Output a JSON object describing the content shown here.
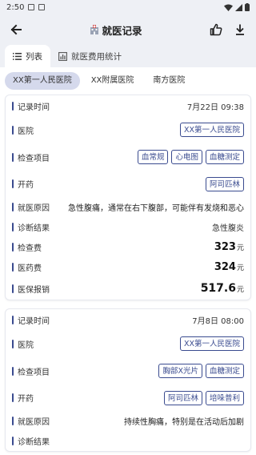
{
  "status": {
    "time": "2:50"
  },
  "header": {
    "title": "就医记录"
  },
  "tabs": [
    {
      "label": "列表",
      "icon": "list-icon"
    },
    {
      "label": "就医费用统计",
      "icon": "chart-icon"
    }
  ],
  "hospitals": [
    "XX第一人民医院",
    "XX附属医院",
    "南方医院"
  ],
  "labels": {
    "time": "记录时间",
    "hospital": "医院",
    "exams": "检查项目",
    "medicine": "开药",
    "reason": "就医原因",
    "diagnosis": "诊断结果",
    "exam_fee": "检查费",
    "medical_fee": "医药费",
    "insurance": "医保报销",
    "unit": "元"
  },
  "records": [
    {
      "time": "7月22日 09:38",
      "hospital": "XX第一人民医院",
      "exams": [
        "血常规",
        "心电图",
        "血糖测定"
      ],
      "medicines": [
        "阿司匹林"
      ],
      "reason": "急性腹痛，通常在右下腹部，可能伴有发烧和恶心",
      "diagnosis": "急性腹炎",
      "exam_fee": "323",
      "medical_fee": "324",
      "insurance": "517.6"
    },
    {
      "time": "7月8日 08:00",
      "hospital": "XX第一人民医院",
      "exams": [
        "胸部X光片",
        "血糖测定"
      ],
      "medicines": [
        "阿司匹林",
        "培哚普利"
      ],
      "reason": "持续性胸痛，特别是在活动后加剧",
      "diagnosis": ""
    }
  ]
}
